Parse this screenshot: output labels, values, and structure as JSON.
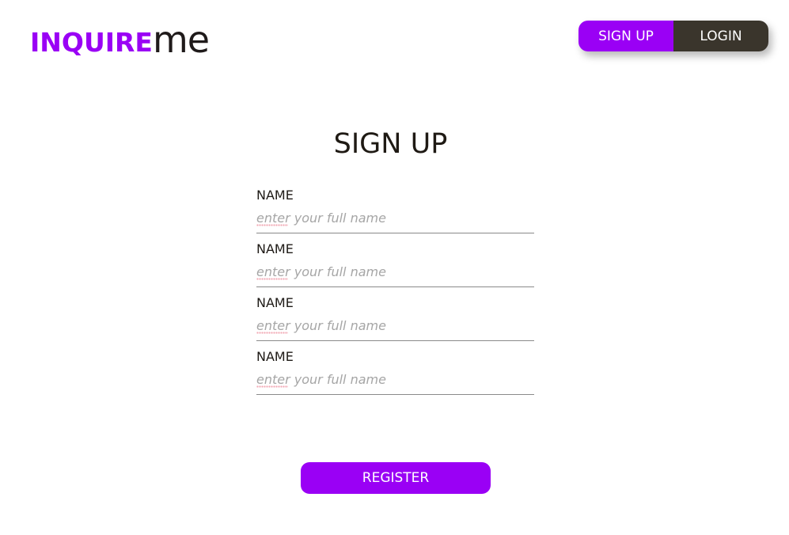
{
  "header": {
    "logo_bold": "INQUIRE",
    "logo_light": "me",
    "signup_label": "SIGN UP",
    "login_label": "LOGIN"
  },
  "form": {
    "title": "SIGN UP",
    "fields": [
      {
        "label": "NAME",
        "placeholder": "enter your full name",
        "value": ""
      },
      {
        "label": "NAME",
        "placeholder": "enter your full name",
        "value": ""
      },
      {
        "label": "NAME",
        "placeholder": "enter your full name",
        "value": ""
      },
      {
        "label": "NAME",
        "placeholder": "enter your full name",
        "value": ""
      }
    ],
    "register_label": "REGISTER"
  },
  "colors": {
    "accent": "#9a00f5",
    "dark": "#3a352c",
    "text": "#1f1a14",
    "placeholder": "#a6a6a6",
    "divider": "#8a8a8a"
  }
}
